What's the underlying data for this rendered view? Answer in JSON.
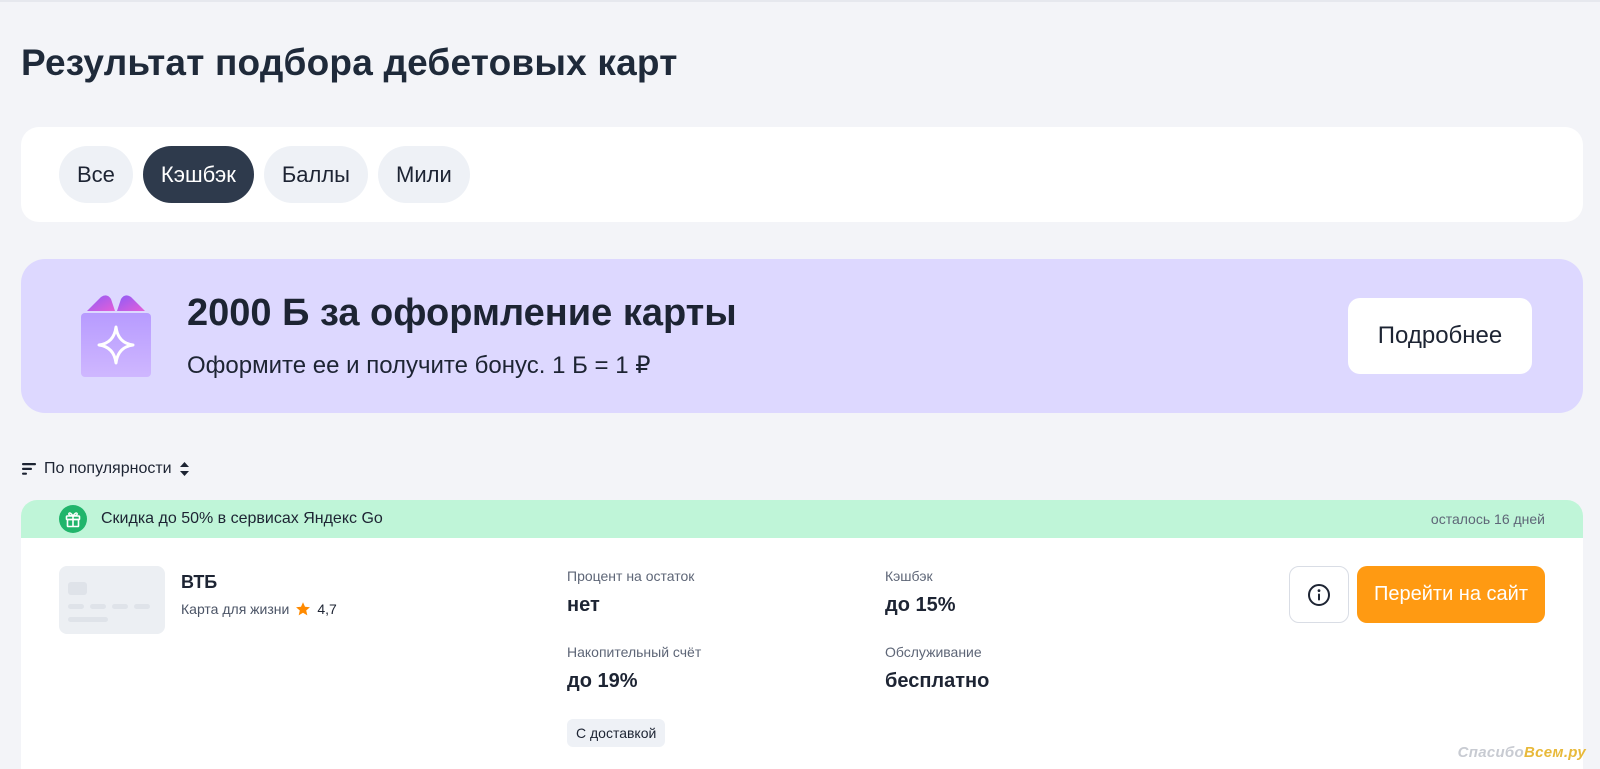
{
  "page": {
    "title": "Результат подбора дебетовых карт"
  },
  "filters": {
    "tabs": [
      {
        "label": "Все",
        "active": false
      },
      {
        "label": "Кэшбэк",
        "active": true
      },
      {
        "label": "Баллы",
        "active": false
      },
      {
        "label": "Мили",
        "active": false
      }
    ]
  },
  "promo": {
    "icon": "gift-icon",
    "title": "2000 Б за оформление карты",
    "subtitle": "Оформите ее и получите бонус. 1 Б = 1 ₽",
    "button_label": "Подробнее"
  },
  "sort": {
    "icon": "sort-lines-icon",
    "label": "По популярности",
    "toggle_icon": "sort-arrows-icon"
  },
  "offer": {
    "banner": {
      "icon": "gift-circle-icon",
      "text": "Скидка до 50% в сервисах Яндекс Go",
      "days_left": "осталось 16 дней"
    },
    "bank": {
      "name": "ВТБ",
      "card_name": "Карта для жизни",
      "rating_icon": "star-icon",
      "rating": "4,7"
    },
    "metrics": {
      "interest_label": "Процент на остаток",
      "interest_value": "нет",
      "cashback_label": "Кэшбэк",
      "cashback_value": "до 15%",
      "savings_label": "Накопительный счёт",
      "savings_value": "до 19%",
      "service_label": "Обслуживание",
      "service_value": "бесплатно"
    },
    "tag": "С доставкой",
    "info_icon": "info-icon",
    "go_button_label": "Перейти на сайт"
  },
  "watermark": {
    "prefix": "Спасибо",
    "accent": "Всем.ру"
  },
  "colors": {
    "background": "#f3f4f8",
    "active_tab": "#2e3a4c",
    "promo_bg": "#ddd8ff",
    "banner_bg": "#bff5d8",
    "accent_orange": "#ff9a12",
    "gift_green": "#21b56b"
  }
}
